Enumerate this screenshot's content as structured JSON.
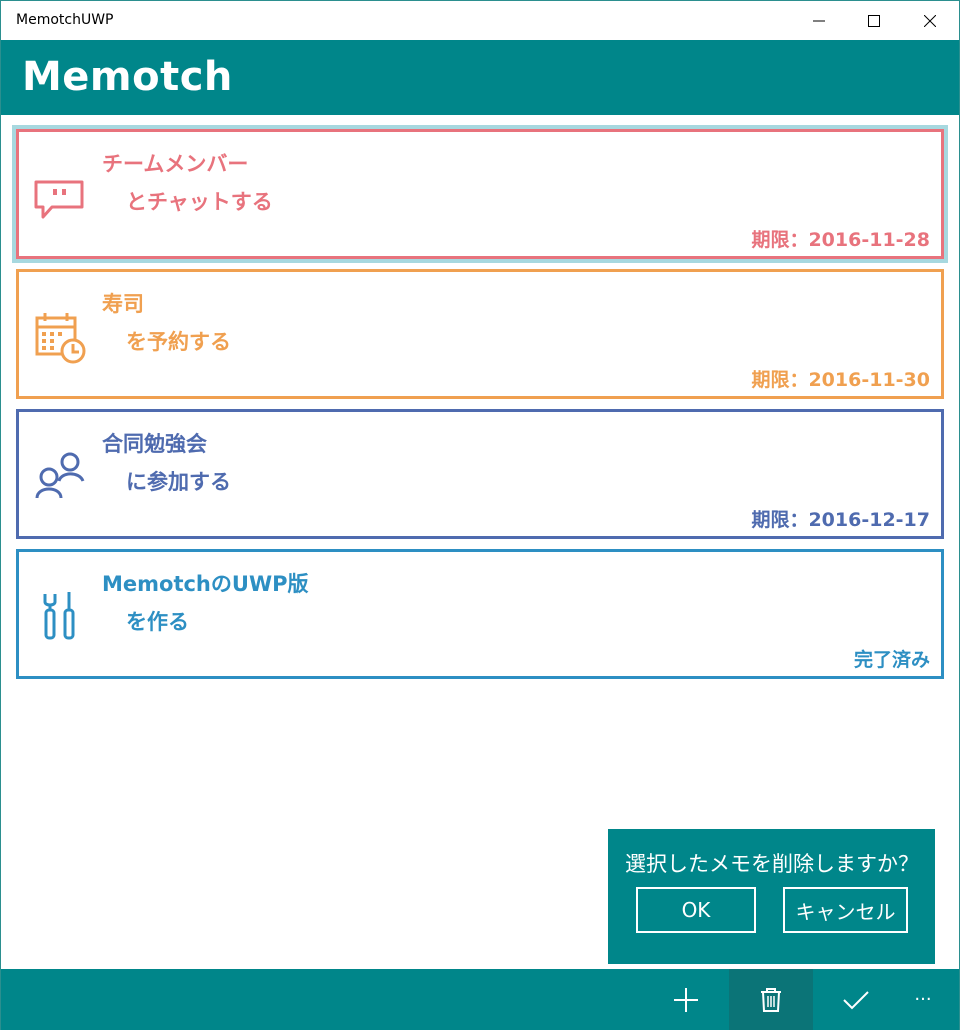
{
  "window": {
    "title": "MemotchUWP"
  },
  "header": {
    "title": "Memotch"
  },
  "memos": [
    {
      "line1": "チームメンバー",
      "line2": "とチャットする",
      "status": "期限：2016-11-28",
      "color": "#e8737d",
      "icon": "chat-icon",
      "selected": true
    },
    {
      "line1": "寿司",
      "line2": "を予約する",
      "status": "期限：2016-11-30",
      "color": "#f0a050",
      "icon": "calendar-clock-icon",
      "selected": false
    },
    {
      "line1": "合同勉強会",
      "line2": "に参加する",
      "status": "期限：2016-12-17",
      "color": "#4f6baf",
      "icon": "people-icon",
      "selected": false
    },
    {
      "line1": "MemotchのUWP版",
      "line2": "を作る",
      "status": "完了済み",
      "color": "#2d8fc3",
      "icon": "tools-icon",
      "selected": false
    }
  ],
  "dialog": {
    "message": "選択したメモを削除しますか？",
    "ok_label": "OK",
    "cancel_label": "キャンセル"
  },
  "appbar": {
    "more_label": "···"
  },
  "colors": {
    "accent": "#00868a",
    "selection": "#a7d8df"
  }
}
